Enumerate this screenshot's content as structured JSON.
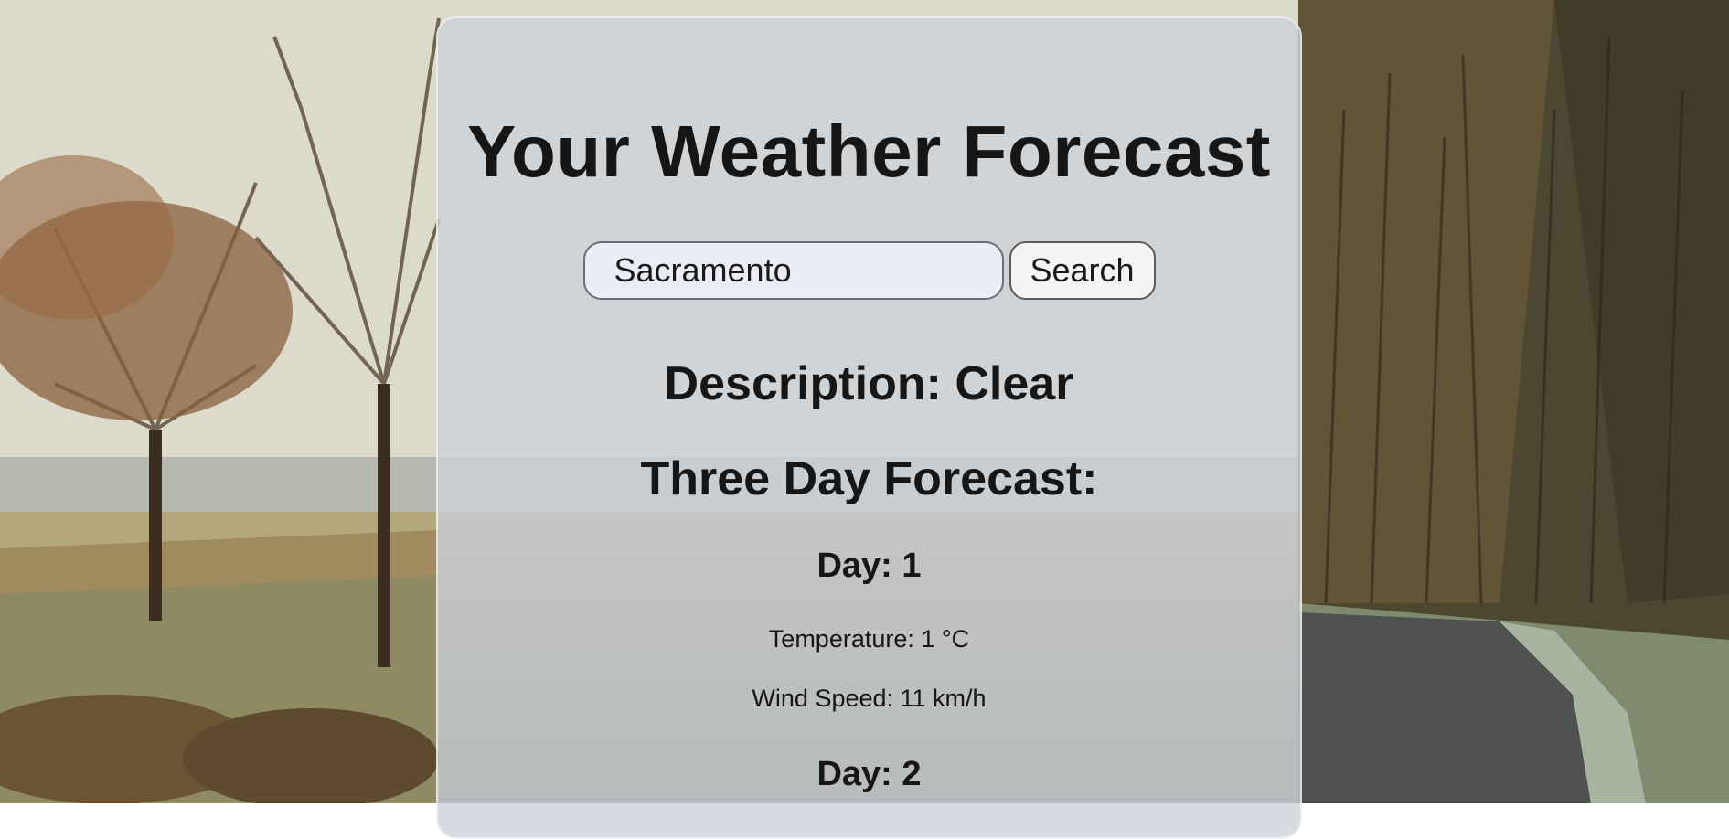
{
  "app": {
    "title": "Your Weather Forecast"
  },
  "search": {
    "value": "Sacramento",
    "button_label": "Search"
  },
  "current": {
    "description": "Description: Clear"
  },
  "forecast": {
    "heading": "Three Day Forecast:",
    "days": [
      {
        "label": "Day: 1",
        "temperature": "Temperature: 1 °C",
        "wind": "Wind Speed: 11 km/h"
      },
      {
        "label": "Day: 2"
      }
    ]
  },
  "colors": {
    "card_background": "#cdd2da",
    "title_text": "#161616",
    "input_background": "#eaedf6",
    "button_background": "#f4f4f2"
  }
}
